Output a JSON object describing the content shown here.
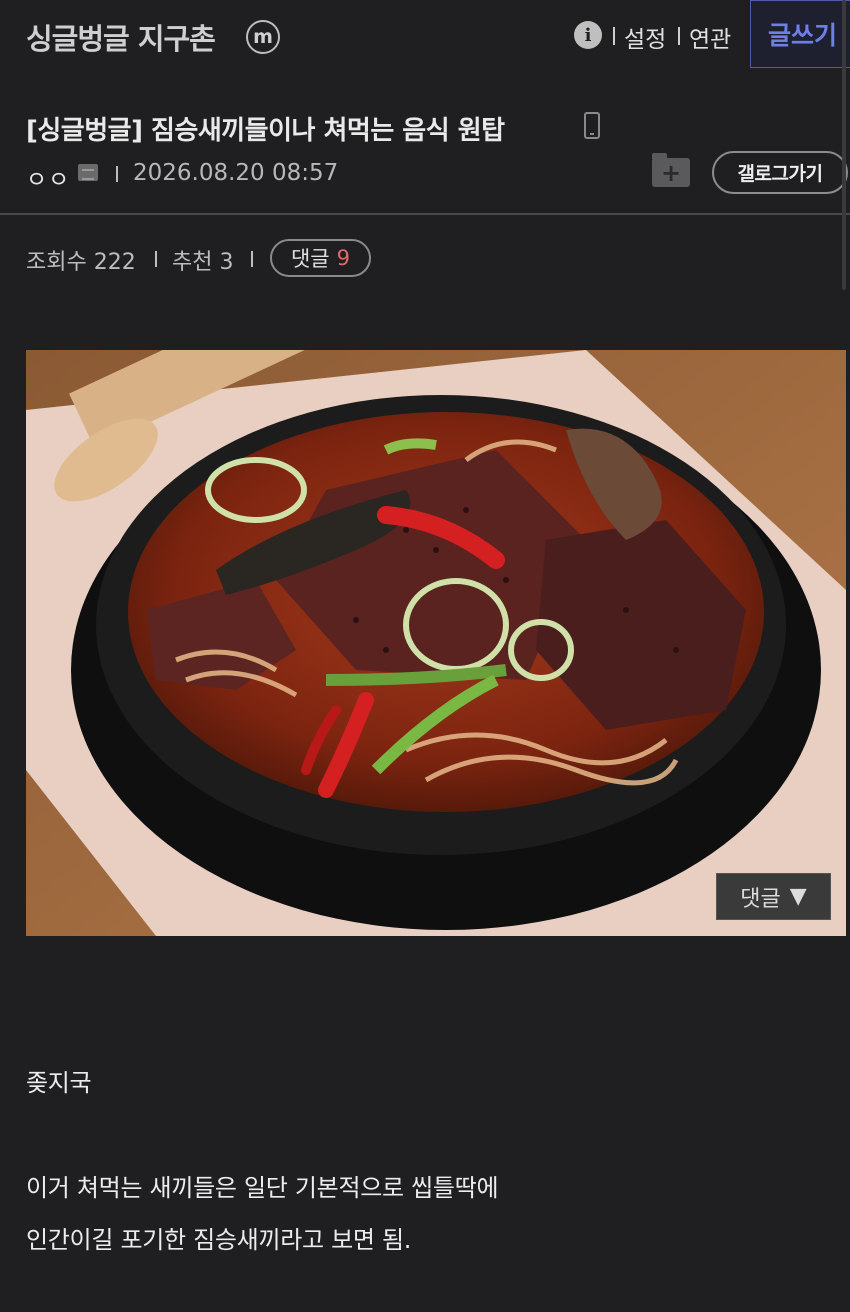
{
  "header": {
    "gallery_title": "싱글벙글 지구촌",
    "badge": "m",
    "info_icon": "info-icon",
    "links": [
      "설정",
      "연관"
    ],
    "write_label": "글쓰기"
  },
  "post": {
    "title": "[싱글벙글] 짐승새끼들이나 쳐먹는 음식 원탑",
    "author": "ㅇㅇ",
    "date": "2026.08.20 08:57",
    "gallery_button": "갤로그가기",
    "views_label": "조회수 222",
    "recommend_label": "추천 3",
    "comments_label": "댓글",
    "comments_count": "9"
  },
  "floating": {
    "comment_label": "댓글",
    "arrow": "▼"
  },
  "content": {
    "paragraphs": [
      "좆지국",
      "이거 쳐먹는 새끼들은 일단 기본적으로 씹틀딱에",
      "인간이길 포기한 짐승새끼라고 보면 됨."
    ]
  },
  "colors": {
    "background": "#1f1f21",
    "accent": "#6e80e6",
    "comment_count": "#e06a6a"
  }
}
